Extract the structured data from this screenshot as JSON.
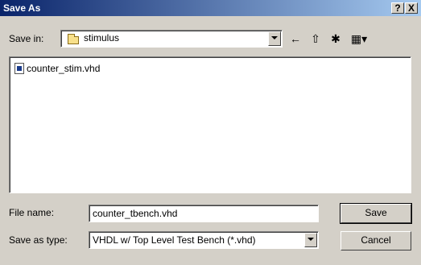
{
  "window": {
    "title": "Save As",
    "help_label": "?",
    "close_label": "X"
  },
  "save_in": {
    "label": "Save in:",
    "value": "stimulus",
    "icon": "folder-icon"
  },
  "toolbar": {
    "back_icon": "←",
    "up_icon": "⇧",
    "new_folder_icon": "✱",
    "view_icon": "▦▾"
  },
  "files": [
    {
      "name": "counter_stim.vhd",
      "icon": "vhd-file-icon"
    }
  ],
  "file_name": {
    "label": "File name:",
    "value": "counter_tbench.vhd"
  },
  "save_as_type": {
    "label": "Save as type:",
    "value": "VHDL w/ Top Level Test Bench (*.vhd)"
  },
  "buttons": {
    "save": "Save",
    "cancel": "Cancel"
  }
}
